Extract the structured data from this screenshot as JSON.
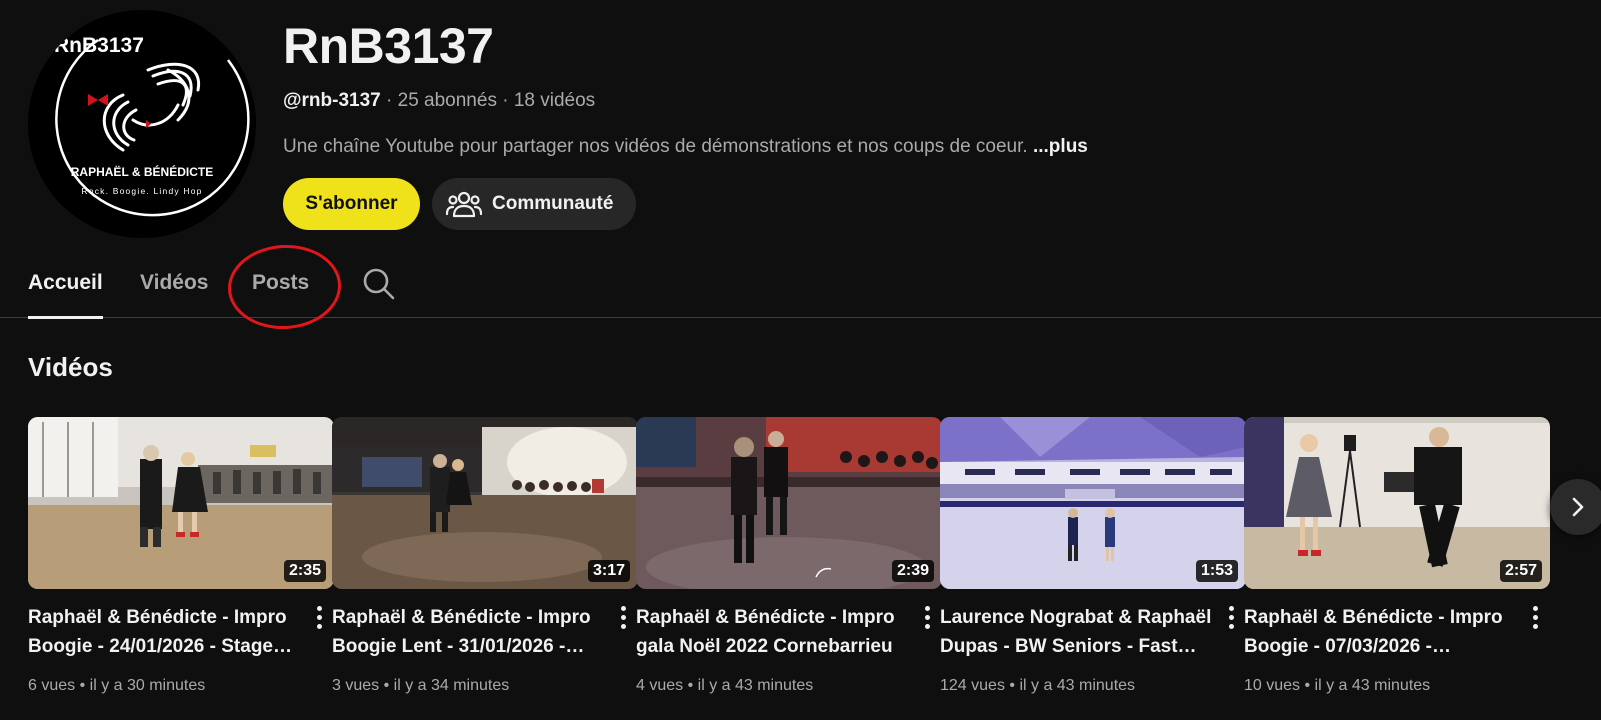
{
  "channel": {
    "avatar": {
      "logo_top_text": "RnB3137",
      "logo_names": "RAPHAËL & BÉNÉDICTE",
      "logo_tagline": "Rock. Boogie. Lindy Hop"
    },
    "title": "RnB3137",
    "handle": "@rnb-3137",
    "separator": " · ",
    "subscribers": "25 abonnés",
    "video_count": "18 vidéos",
    "description": "Une chaîne Youtube pour partager nos vidéos de démonstrations et nos coups de coeur.",
    "more_label": "...plus",
    "subscribe_label": "S'abonner",
    "community_label": "Communauté"
  },
  "tabs": [
    {
      "label": "Accueil",
      "active": true
    },
    {
      "label": "Vidéos",
      "active": false
    },
    {
      "label": "Posts",
      "active": false
    }
  ],
  "section": {
    "title": "Vidéos"
  },
  "videos": [
    {
      "title": "Raphaël & Bénédicte - Impro Boogie - 24/01/2026 - Stage…",
      "duration": "2:35",
      "views": "6 vues",
      "age": "il y a 30 minutes"
    },
    {
      "title": "Raphaël & Bénédicte - Impro Boogie Lent - 31/01/2026 -…",
      "duration": "3:17",
      "views": "3 vues",
      "age": "il y a 34 minutes"
    },
    {
      "title": "Raphaël & Bénédicte - Impro gala Noël 2022 Cornebarrieu",
      "duration": "2:39",
      "views": "4 vues",
      "age": "il y a 43 minutes"
    },
    {
      "title": "Laurence Nograbat & Raphaël Dupas - BW Seniors - Fast…",
      "duration": "1:53",
      "views": "124 vues",
      "age": "il y a 43 minutes"
    },
    {
      "title": "Raphaël & Bénédicte - Impro Boogie - 07/03/2026 -…",
      "duration": "2:57",
      "views": "10 vues",
      "age": "il y a 43 minutes"
    }
  ],
  "meta_separator": " • ",
  "colors": {
    "background": "#0f0f0f",
    "subscribe": "#f0e21a",
    "annotation": "#e0161b"
  },
  "icons": [
    "community-icon",
    "search-icon",
    "kebab-menu-icon",
    "chevron-right-icon"
  ]
}
